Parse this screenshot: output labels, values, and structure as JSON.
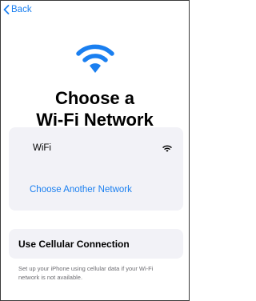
{
  "nav": {
    "back_label": "Back"
  },
  "header": {
    "icon": "wifi-icon",
    "title_line1": "Choose a",
    "title_line2": "Wi-Fi Network"
  },
  "networks": {
    "items": [
      {
        "ssid": "WiFi",
        "icon": "wifi-signal-icon"
      }
    ],
    "other_label": "Choose Another Network"
  },
  "cellular": {
    "button_label": "Use Cellular Connection",
    "footnote_line1": "Set up your iPhone using cellular data if your Wi-Fi",
    "footnote_line2": "network is not available."
  },
  "colors": {
    "accent": "#1a7ff0",
    "card_bg": "#f2f2f7",
    "secondary_text": "#6d6d72"
  }
}
